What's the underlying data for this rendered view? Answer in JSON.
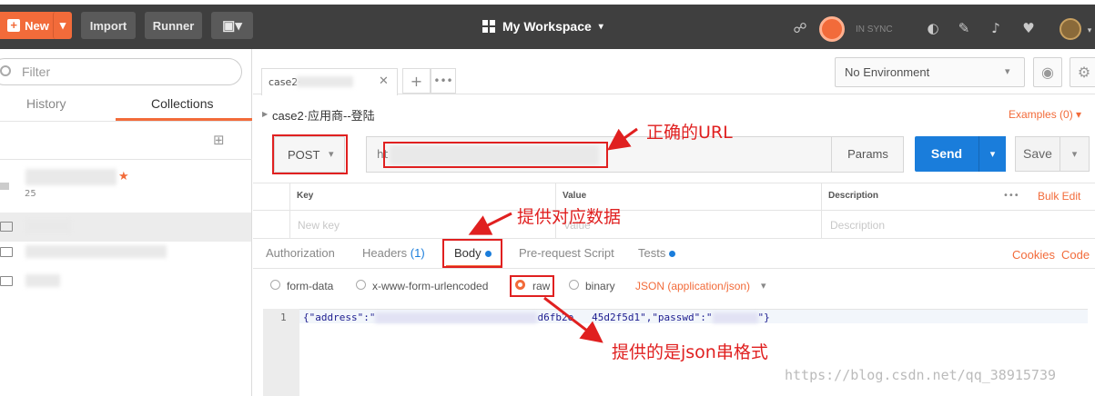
{
  "toolbar": {
    "new_label": "New",
    "import_label": "Import",
    "runner_label": "Runner",
    "workspace_label": "My Workspace",
    "sync_status": "IN SYNC"
  },
  "sidebar": {
    "filter_placeholder": "Filter",
    "tabs": [
      {
        "label": "History"
      },
      {
        "label": "Collections"
      }
    ],
    "active_tab": "Collections",
    "items": [
      {
        "label": "25"
      }
    ]
  },
  "tabs": {
    "request_tab_label": "case2·"
  },
  "environment": {
    "selected": "No Environment"
  },
  "request": {
    "name": "case2·应用商--登陆",
    "examples_label": "Examples (0)",
    "method": "POST",
    "url_prefix": "ht",
    "params_label": "Params",
    "send_label": "Send",
    "save_label": "Save"
  },
  "params_table": {
    "headers": [
      "Key",
      "Value",
      "Description"
    ],
    "bulk_edit_label": "Bulk Edit",
    "placeholders": [
      "New key",
      "Value",
      "Description"
    ]
  },
  "request_tabs": {
    "authorization": "Authorization",
    "headers": "Headers",
    "headers_count": "(1)",
    "body": "Body",
    "prerequest": "Pre-request Script",
    "tests": "Tests",
    "cookies": "Cookies",
    "code": "Code"
  },
  "body_types": {
    "form_data": "form-data",
    "urlencoded": "x-www-form-urlencoded",
    "raw": "raw",
    "binary": "binary",
    "content_type": "JSON (application/json)",
    "selected": "raw"
  },
  "editor": {
    "line_number": "1",
    "code_start": "{\"address\":\"",
    "code_mid": "d6fb2e   45d2f5d1\",\"passwd\":\"",
    "code_end": "\"}"
  },
  "annotations": {
    "url_note": "正确的URL",
    "body_note": "提供对应数据",
    "json_note": "提供的是json串格式"
  },
  "watermark": "https://blog.csdn.net/qq_38915739",
  "colors": {
    "accent": "#f26b3a",
    "send": "#1a7ddb",
    "annotation": "#e02020"
  }
}
